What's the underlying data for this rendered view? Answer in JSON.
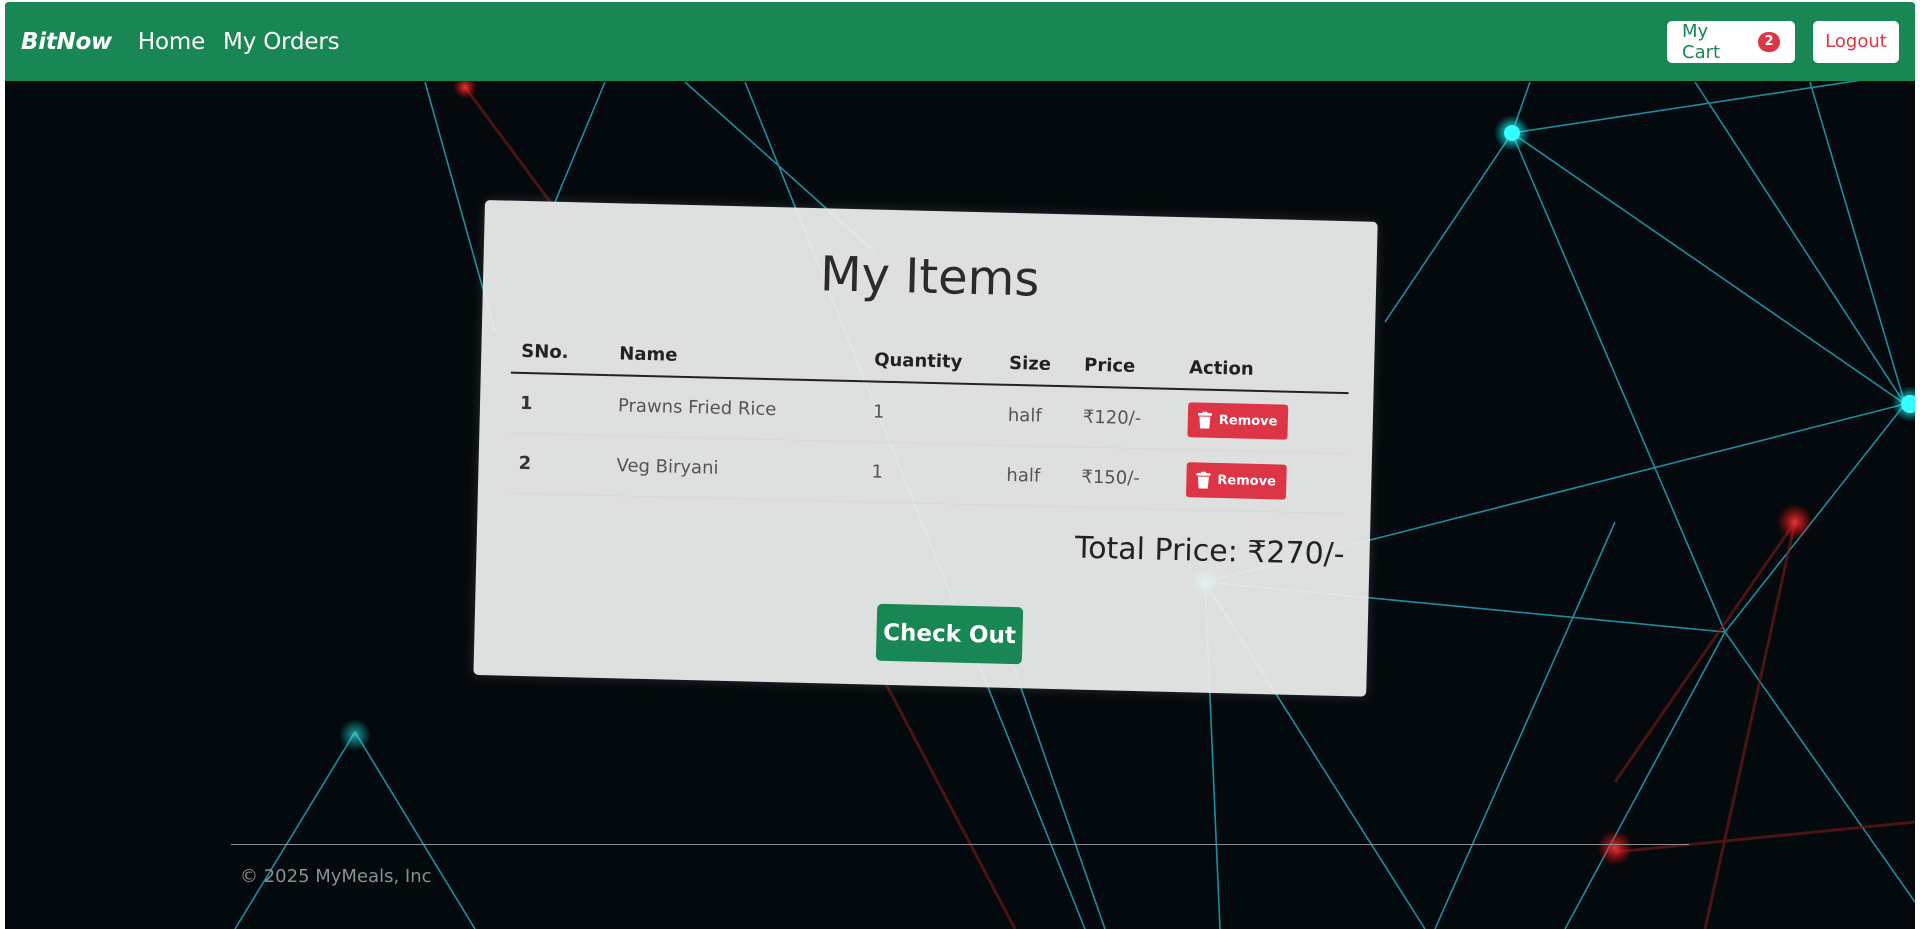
{
  "navbar": {
    "brand": "BitNow",
    "links": [
      "Home",
      "My Orders"
    ],
    "cart_label": "My Cart",
    "cart_count": "2",
    "logout_label": "Logout"
  },
  "cart": {
    "title": "My Items",
    "columns": [
      "SNo.",
      "Name",
      "Quantity",
      "Size",
      "Price",
      "Action"
    ],
    "rows": [
      {
        "sno": "1",
        "name": "Prawns Fried Rice",
        "quantity": "1",
        "size": "half",
        "price": "₹120/-",
        "action": "Remove"
      },
      {
        "sno": "2",
        "name": "Veg Biryani",
        "quantity": "1",
        "size": "half",
        "price": "₹150/-",
        "action": "Remove"
      }
    ],
    "total": "Total Price: ₹270/-",
    "checkout_label": "Check Out"
  },
  "footer": {
    "copyright": "© 2025 MyMeals, Inc"
  },
  "colors": {
    "primary": "#198754",
    "danger": "#dc3545",
    "background": "#03090c"
  },
  "icons": {
    "remove_icon": "trash-icon",
    "background": "network-lines-background"
  }
}
